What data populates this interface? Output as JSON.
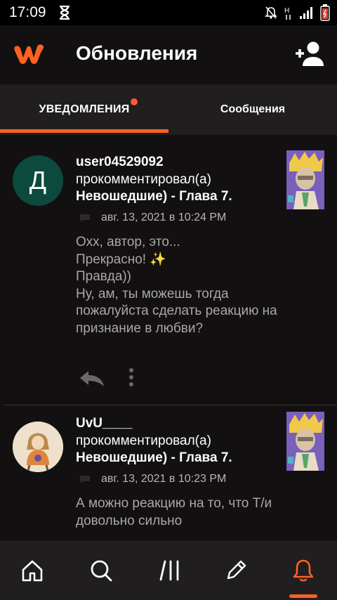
{
  "status_bar": {
    "time": "17:09",
    "icons": [
      "hourglass-icon",
      "notifications-muted-icon",
      "signal-h-icon",
      "signal-bars-icon",
      "battery-icon"
    ]
  },
  "app_bar": {
    "logo": "wattpad-logo",
    "title": "Обновления",
    "add_user_icon": "add-person-icon"
  },
  "tabs": [
    {
      "label": "УВЕДОМЛЕНИЯ",
      "active": true,
      "has_dot": true
    },
    {
      "label": "Сообщения",
      "active": false,
      "has_dot": false
    }
  ],
  "notifications": [
    {
      "avatar_letter": "Д",
      "username": "user04529092",
      "action": "прокомментировал(а)",
      "story": "Невошедшие) - Глава 7.",
      "timestamp": "авг. 13, 2021 в 10:24 PM",
      "comment": "Охх, автор, это...\nПрекрасно! ✨\nПравда))\nНу, ам, ты можешь тогда пожалуйста сделать реакцию на признание в любви?"
    },
    {
      "avatar_letter": "",
      "username": "UvU____",
      "action": "прокомментировал(а)",
      "story": "Невошедшие) - Глава 7.",
      "timestamp": "авг. 13, 2021 в 10:23 PM",
      "comment": "А можно реакцию на то, что Т/и довольно сильно"
    }
  ],
  "bottom_nav": [
    {
      "icon": "home-icon",
      "active": false
    },
    {
      "icon": "search-icon",
      "active": false
    },
    {
      "icon": "library-icon",
      "active": false
    },
    {
      "icon": "pencil-icon",
      "active": false
    },
    {
      "icon": "bell-icon",
      "active": true
    }
  ],
  "colors": {
    "accent": "#ff6122",
    "background": "#121011",
    "tab_bar": "#201e1f",
    "avatar_green": "#0c4a3d"
  }
}
